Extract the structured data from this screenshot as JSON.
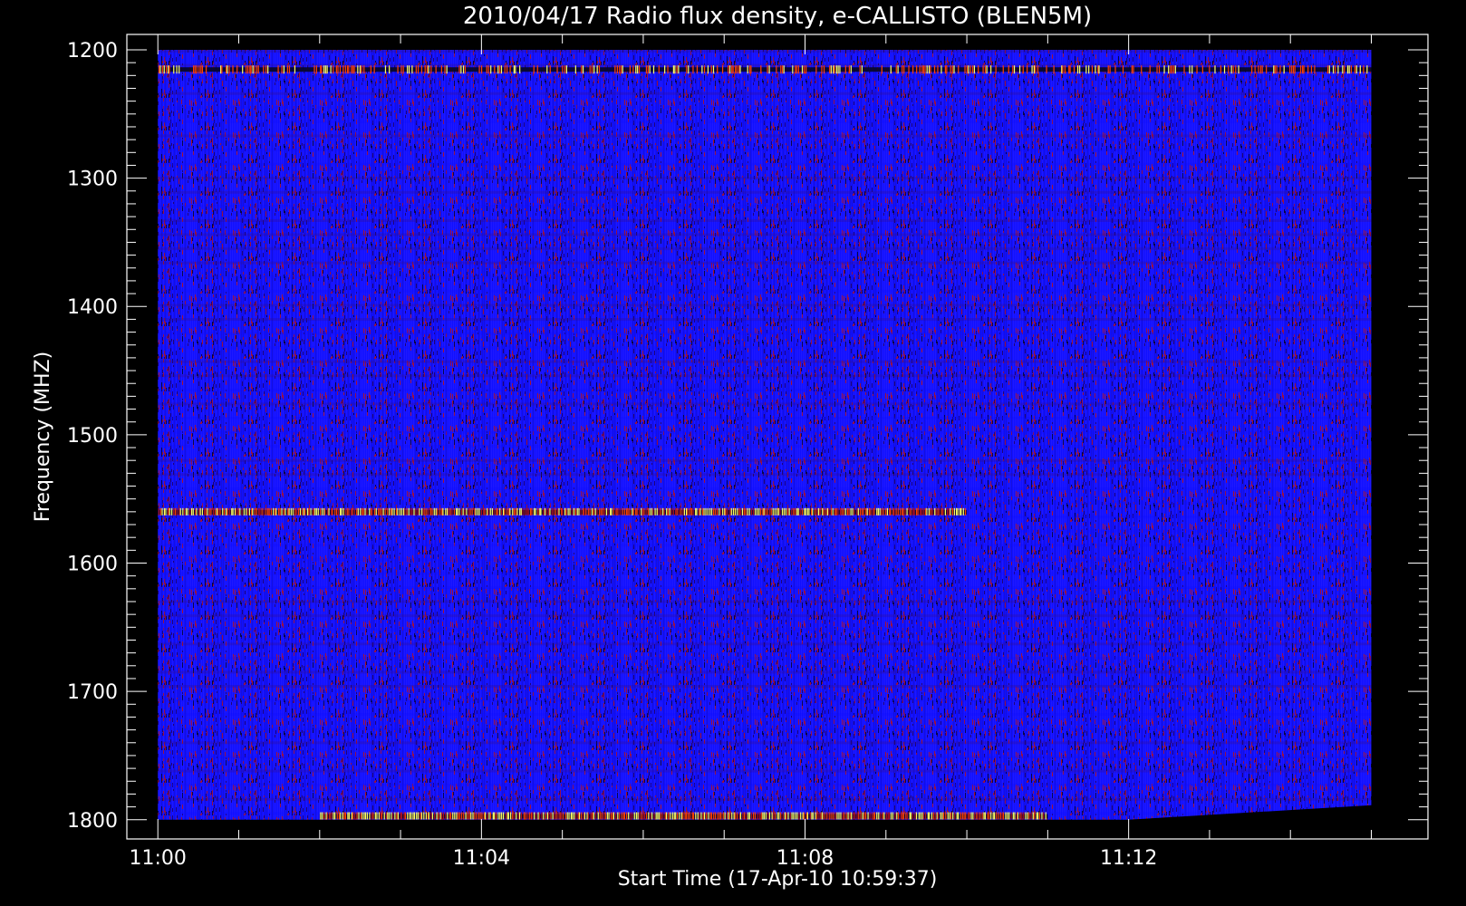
{
  "chart_data": {
    "type": "heatmap",
    "title": "2010/04/17  Radio flux density, e-CALLISTO (BLEN5M)",
    "xlabel": "Start Time (17-Apr-10 10:59:37)",
    "ylabel": "Frequency (MHZ)",
    "x_axis": {
      "range": [
        "10:59:37",
        "11:15:42"
      ],
      "tick_labels": [
        "11:00",
        "11:04",
        "11:08",
        "11:12"
      ],
      "data_range": [
        "11:00",
        "11:15"
      ]
    },
    "y_axis": {
      "range": [
        1188,
        1815
      ],
      "inverted": true,
      "tick_labels": [
        "1200",
        "1300",
        "1400",
        "1500",
        "1600",
        "1700",
        "1800"
      ],
      "data_range": [
        1200,
        1800
      ]
    },
    "background_colormap": "blue-red-yellow",
    "features": [
      {
        "frequency_mhz": 1215,
        "time_range": [
          "11:00",
          "11:15"
        ],
        "intensity": "high",
        "pattern": "intermittent"
      },
      {
        "frequency_mhz": 1560,
        "time_range": [
          "11:00",
          "11:10"
        ],
        "intensity": "high",
        "pattern": "continuous"
      },
      {
        "frequency_mhz": 1797,
        "time_range": [
          "11:02",
          "11:11"
        ],
        "intensity": "very high",
        "pattern": "continuous"
      }
    ],
    "grid": false,
    "legend": "none"
  },
  "colors": {
    "background": "#000000",
    "axis": "#ffffff",
    "low": "#1010ff",
    "mid": "#b01020",
    "high": "#ff4000",
    "peak": "#ffff60"
  }
}
